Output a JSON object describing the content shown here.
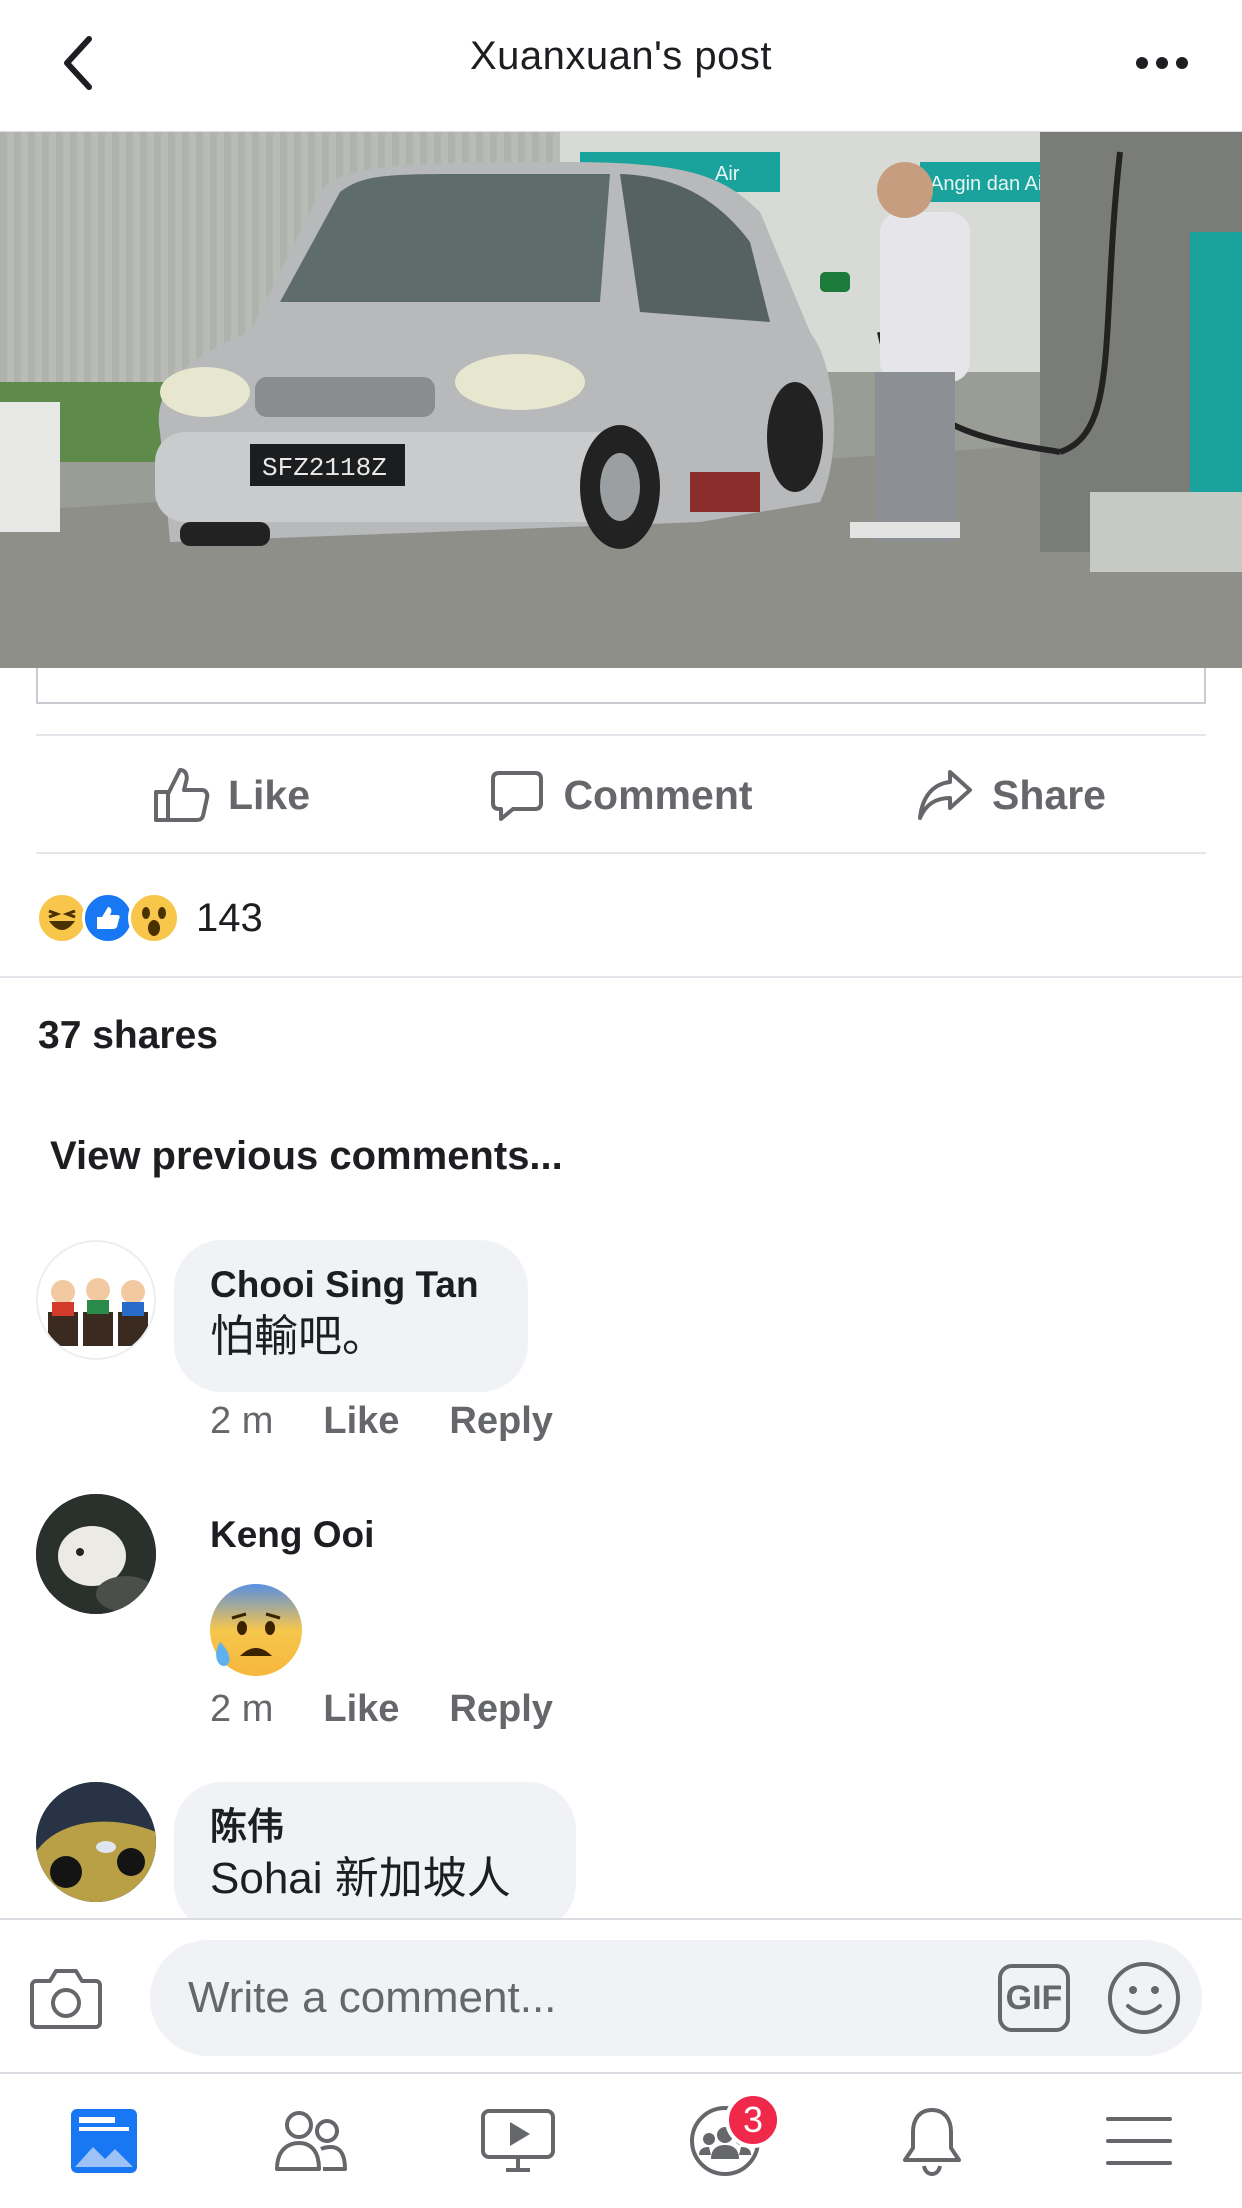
{
  "header": {
    "title": "Xuanxuan's post",
    "back_icon": "chevron-left-icon",
    "more_icon": "more-horizontal-icon"
  },
  "post": {
    "photo_alt": "SFZ2118Z",
    "photo_sign_left": "Air",
    "photo_sign_right": "Angin dan Ai",
    "actions": {
      "like_label": "Like",
      "comment_label": "Comment",
      "share_label": "Share"
    },
    "reactions": {
      "icons": [
        "haha-reaction-icon",
        "like-reaction-icon",
        "wow-reaction-icon"
      ],
      "count": "143"
    },
    "shares_text": "37 shares",
    "view_previous": "View previous comments..."
  },
  "comments": [
    {
      "name": "Chooi Sing Tan",
      "text": "怕輸吧。",
      "time": "2 m",
      "like": "Like",
      "reply": "Reply"
    },
    {
      "name": "Keng Ooi",
      "text": "",
      "emoji": "anxious-sweat-emoji",
      "time": "2 m",
      "like": "Like",
      "reply": "Reply"
    },
    {
      "name": "陈伟",
      "text": "Sohai 新加坡人"
    }
  ],
  "composer": {
    "placeholder": "Write a comment...",
    "gif_label": "GIF"
  },
  "tabbar": {
    "items": [
      "news-feed-icon",
      "friends-icon",
      "watch-icon",
      "groups-icon",
      "notifications-icon",
      "menu-icon"
    ],
    "groups_badge": "3"
  },
  "colors": {
    "accent": "#1877f2",
    "badge": "#f02849",
    "secondary_text": "#65676b",
    "bubble": "#f0f2f5"
  }
}
